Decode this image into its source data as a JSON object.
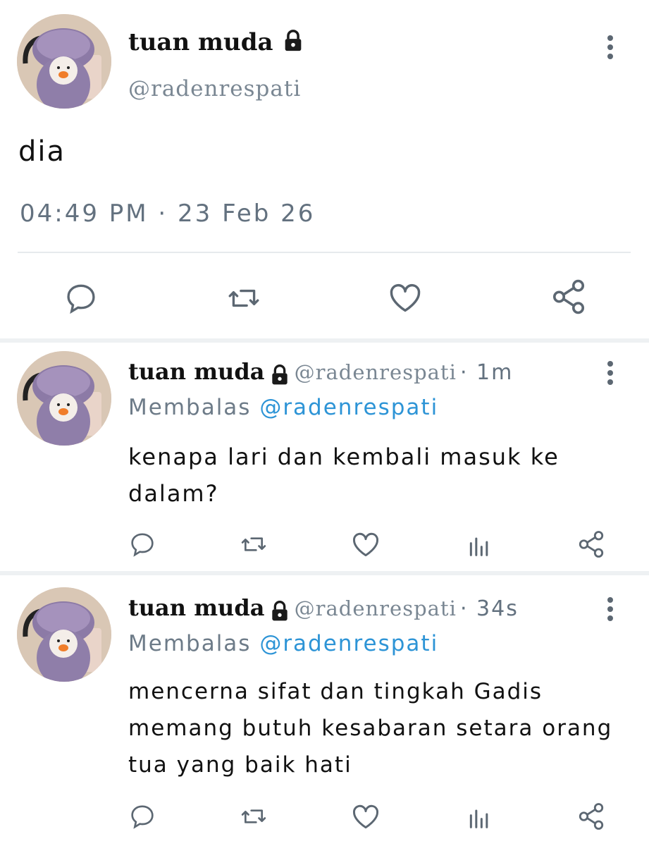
{
  "main_tweet": {
    "display_name": "tuan muda",
    "handle": "@radenrespati",
    "text": "dia",
    "timestamp": "04:49 PM · 23 Feb 26",
    "actions": [
      "reply-icon",
      "retweet-icon",
      "like-icon",
      "share-icon"
    ]
  },
  "replies": [
    {
      "display_name": "tuan muda",
      "handle": "@radenrespati",
      "time": "· 1m",
      "reply_prefix": "Membalas",
      "reply_to": "@radenrespati",
      "text_lines": [
        "kenapa lari dan kembali masuk ke",
        "dalam?"
      ]
    },
    {
      "display_name": "tuan muda",
      "handle": "@radenrespati",
      "time": "· 34s",
      "reply_prefix": "Membalas",
      "reply_to": "@radenrespati",
      "text_lines": [
        "mencerna sifat dan tingkah Gadis",
        "memang butuh kesabaran setara orang",
        "tua yang baik hati"
      ]
    }
  ],
  "colors": {
    "accent": "#2d94d6",
    "muted": "#63717f",
    "avatar_bg": "#d8c8b8",
    "hat": "#7d6a94"
  }
}
